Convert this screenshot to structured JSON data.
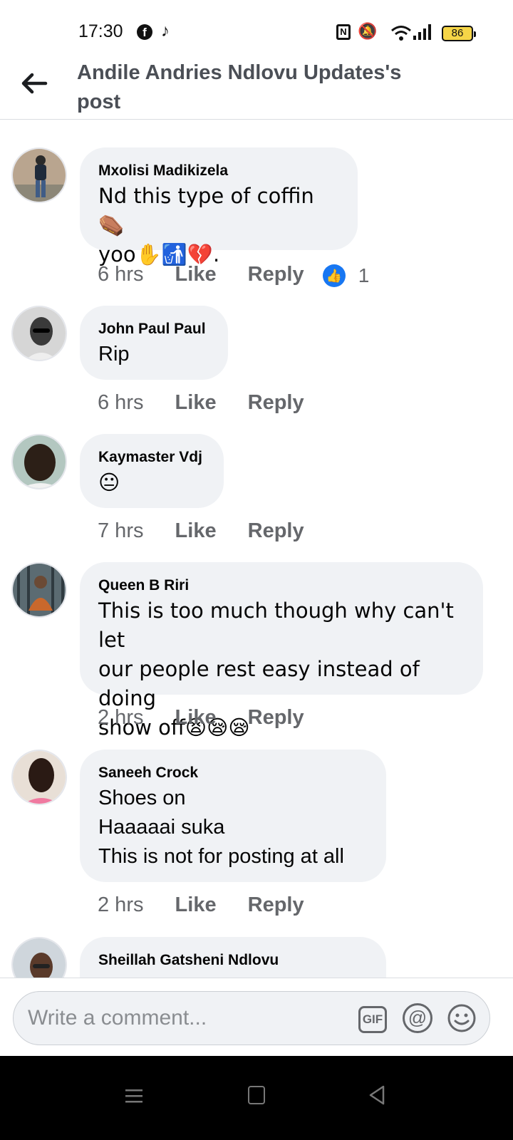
{
  "status_bar": {
    "time": "17:30",
    "battery": "86",
    "icons": [
      "facebook-icon",
      "tiktok-icon",
      "nfc-icon",
      "mute-icon",
      "wifi-icon",
      "signal-icon",
      "battery-icon"
    ]
  },
  "header": {
    "title": "Andile Andries Ndlovu Updates's post",
    "back_icon": "back-arrow-icon"
  },
  "comments": [
    {
      "name": "Mxolisi Madikizela",
      "text": "Nd this type of coffin ⚰️\nyoo✋🚮💔.",
      "time": "6 hrs",
      "like": "Like",
      "reply": "Reply",
      "reaction_count": "1"
    },
    {
      "name": "John Paul Paul",
      "text": "Rip",
      "time": "6 hrs",
      "like": "Like",
      "reply": "Reply"
    },
    {
      "name": "Kaymaster Vdj",
      "text": "😐",
      "time": "7 hrs",
      "like": "Like",
      "reply": "Reply"
    },
    {
      "name": "Queen B Riri",
      "text": "This is too much though why can't let\nour people rest easy instead of doing\nshow off😫😪😪",
      "time": "2 hrs",
      "like": "Like",
      "reply": "Reply"
    },
    {
      "name": "Saneeh Crock",
      "text": "Shoes on\nHaaaaai suka\nThis is not for posting at all",
      "time": "2 hrs",
      "like": "Like",
      "reply": "Reply"
    },
    {
      "name": "Sheillah Gatsheni Ndlovu",
      "text": ""
    }
  ],
  "composer": {
    "placeholder": "Write a comment...",
    "gif_label": "GIF",
    "at_label": "@"
  },
  "colors": {
    "bubble": "#f0f2f5",
    "meta_text": "#65676b",
    "like_reaction": "#1877f2",
    "battery_fill": "#f5d547"
  }
}
